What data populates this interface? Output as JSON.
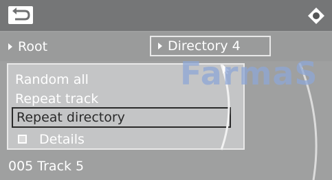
{
  "header": {
    "back_icon": "back-arrow-icon",
    "menu_icon": "diamond-menu-icon"
  },
  "nav": {
    "root_label": "Root",
    "directory_label": "Directory 4"
  },
  "menu": {
    "items": [
      {
        "label": "Random all"
      },
      {
        "label": "Repeat track"
      },
      {
        "label": "Repeat directory",
        "selected": true
      },
      {
        "label": "Details",
        "icon": "checkbox-icon"
      }
    ]
  },
  "status": {
    "track": "005 Track 5"
  },
  "watermark": {
    "text": "FarmaS"
  },
  "colors": {
    "background": "#9fa0a0",
    "topbar": "#757677",
    "panel": "#c4c5c6",
    "selection_border": "#2a2a2a",
    "text": "#ffffff",
    "watermark": "#8ea7d6"
  }
}
